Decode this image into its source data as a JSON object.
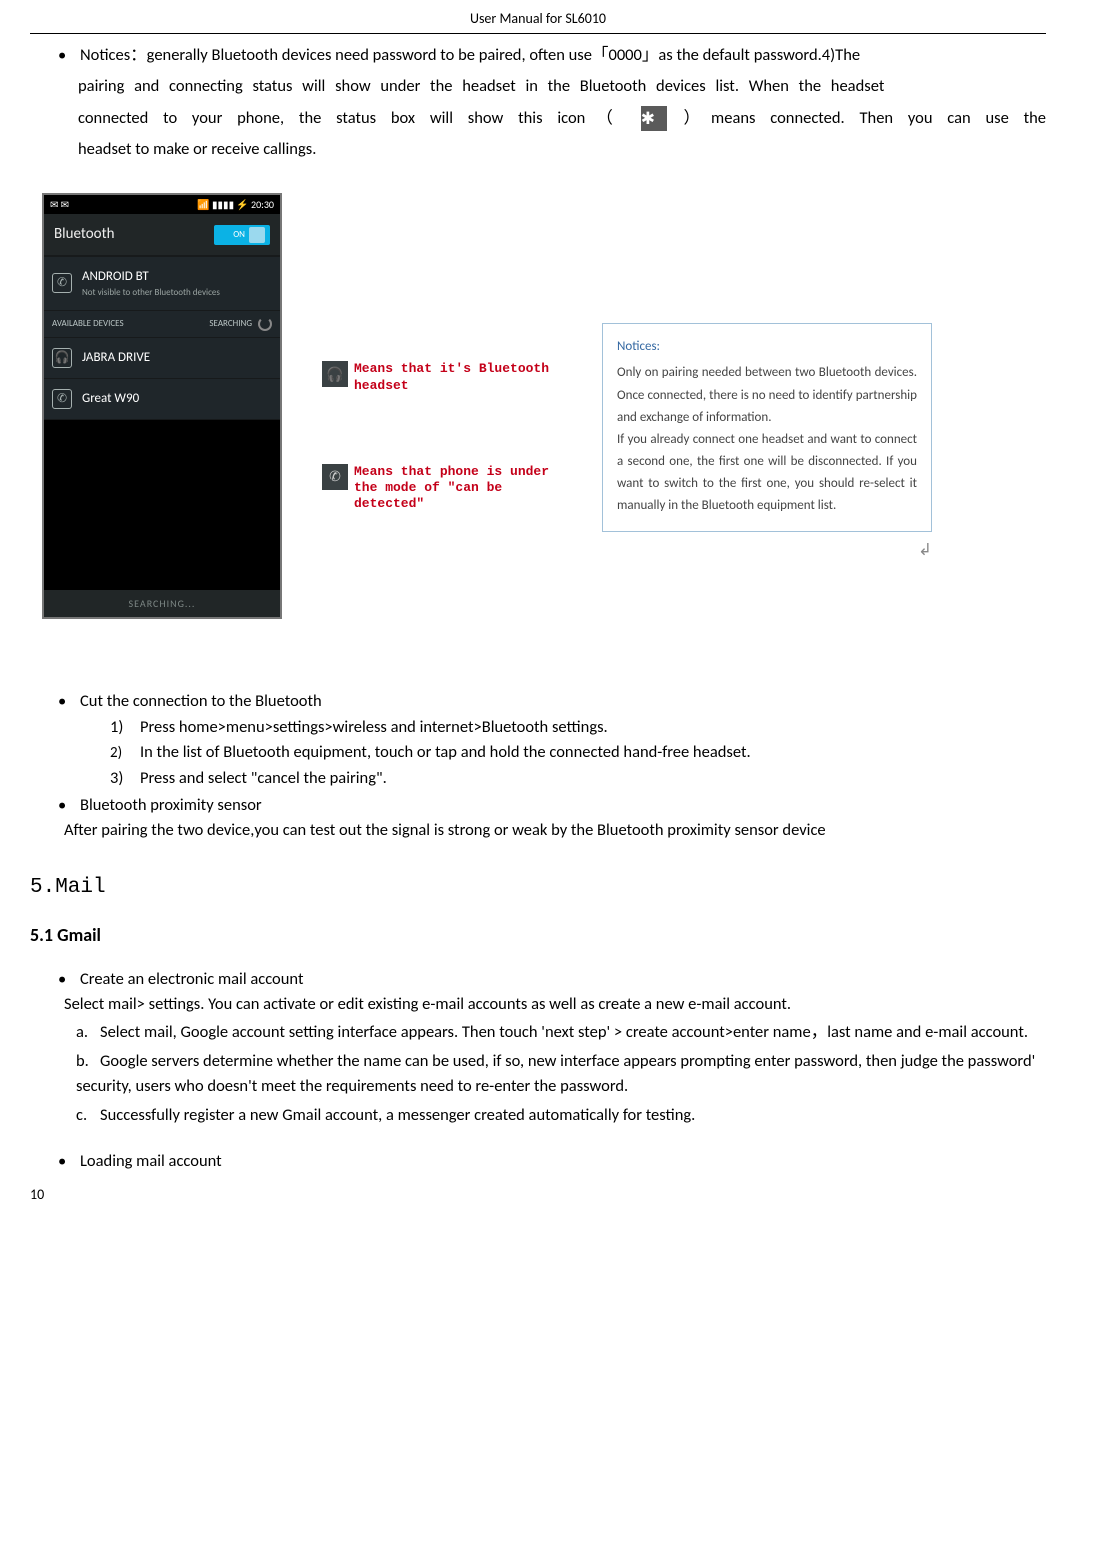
{
  "header": {
    "title": "User Manual for SL6010"
  },
  "intro": {
    "notices_line1": "Notices：generally Bluetooth devices need password to be paired, often use「0000」as the default password.4)The",
    "notices_line2": "pairing and connecting status will show under the headset in the Bluetooth devices list. When the headset",
    "notices_line3a": "connected to your phone, the status box will show this icon（",
    "notices_line3b": "）means connected. Then you can use the",
    "notices_line4": "headset to make or receive callings."
  },
  "phone": {
    "status_left": "✉ ✉",
    "status_right": "📶 ▮▮▮▮ ⚡ 20:30",
    "bluetooth_label": "Bluetooth",
    "toggle_label": "ON",
    "device_name": "ANDROID BT",
    "device_sub": "Not visible to other Bluetooth devices",
    "available_label": "AVAILABLE DEVICES",
    "searching_label": "SEARCHING",
    "dev1": "JABRA DRIVE",
    "dev2": "Great W90",
    "searching_footer": "SEARCHING..."
  },
  "annotations": {
    "annot1": "Means that it's Bluetooth headset",
    "annot2": "Means that phone is under the mode of \"can be detected\""
  },
  "notice_box": {
    "title": "Notices:",
    "p1": "Only on pairing needed between two Bluetooth devices. Once connected, there is no need to identify partnership and exchange of information.",
    "p2": "If you already connect one headset and want to connect a second one, the first one will be disconnected. If you want to switch to the first one, you should re-select it manually in the Bluetooth equipment list."
  },
  "cut_conn": {
    "title": "Cut the connection to the Bluetooth",
    "s1": "Press home>menu>settings>wireless and internet>Bluetooth settings.",
    "s2": "In the list of Bluetooth equipment, touch or tap and hold the connected hand-free headset.",
    "s3": "Press and select \"cancel the pairing\"."
  },
  "proximity": {
    "title": "Bluetooth proximity sensor",
    "text": "After pairing the two device,you can test out the signal is strong or weak by the Bluetooth proximity sensor device"
  },
  "section5": {
    "heading": "5.Mail"
  },
  "gmail": {
    "heading": "5.1 Gmail",
    "b1": "Create an electronic mail account",
    "p1": "Select mail> settings. You can activate or edit existing e-mail accounts as well as create a new e-mail account.",
    "a": "Select mail, Google account setting interface appears. Then touch 'next step' > create account>enter name，last name and e-mail account.",
    "b": "Google servers determine whether the name can be used, if so, new interface appears prompting enter password, then judge the password' security, users who doesn't meet the requirements need to re-enter the password.",
    "c": "Successfully register a new Gmail account, a messenger created automatically for testing.",
    "b2": "Loading mail account"
  },
  "page_number": "10"
}
